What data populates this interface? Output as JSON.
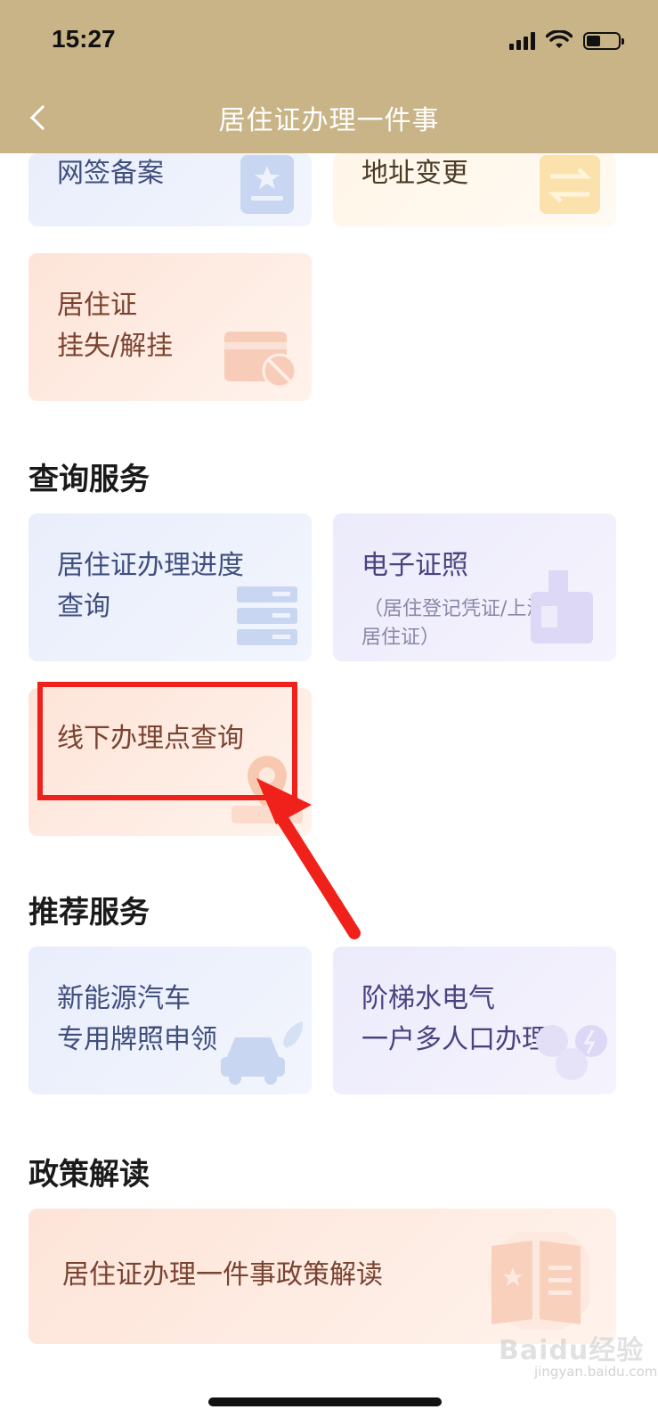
{
  "status": {
    "time": "15:27"
  },
  "nav": {
    "title": "居住证办理一件事"
  },
  "cards_top": [
    {
      "label": "网签备案"
    },
    {
      "label": "地址变更"
    },
    {
      "line1": "居住证",
      "line2": "挂失/解挂"
    }
  ],
  "sections": {
    "query": {
      "title": "查询服务",
      "cards": [
        {
          "line1": "居住证办理进度",
          "line2": "查询"
        },
        {
          "line1": "电子证照",
          "sub1": "（居住登记凭证/上海市",
          "sub2": "居住证）"
        },
        {
          "line1": "线下办理点查询"
        }
      ]
    },
    "recommend": {
      "title": "推荐服务",
      "cards": [
        {
          "line1": "新能源汽车",
          "line2": "专用牌照申领"
        },
        {
          "line1": "阶梯水电气",
          "line2": "一户多人口办理"
        }
      ]
    },
    "policy": {
      "title": "政策解读",
      "card": {
        "label": "居住证办理一件事政策解读"
      }
    }
  },
  "watermark": {
    "text": "Baidu经验",
    "sub": "jingyan.baidu.com"
  },
  "colors": {
    "nav_bg": "#c8b487",
    "highlight": "#f0201a"
  }
}
